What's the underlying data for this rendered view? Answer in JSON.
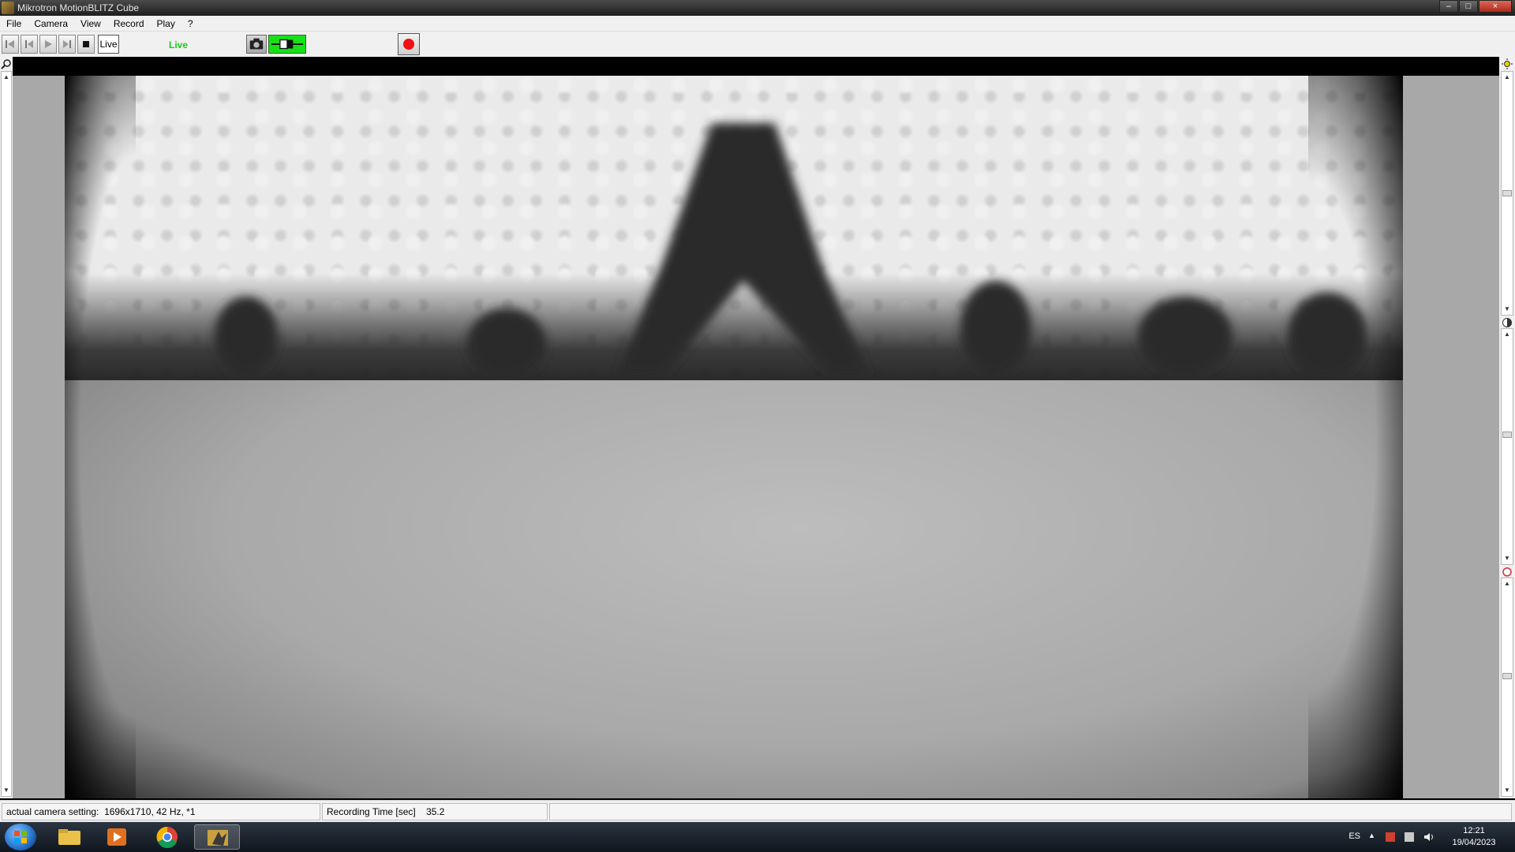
{
  "window": {
    "title": "Mikrotron MotionBLITZ Cube"
  },
  "menu": [
    "File",
    "Camera",
    "View",
    "Record",
    "Play",
    "?"
  ],
  "toolbar": {
    "live_button": "Live",
    "live_status": "Live"
  },
  "status": {
    "camera_setting_label": "actual camera setting:",
    "camera_setting_value": "1696x1710, 42 Hz, *1",
    "recording_time_label": "Recording Time [sec]",
    "recording_time_value": "35.2"
  },
  "taskbar": {
    "language": "ES",
    "time": "12:21",
    "date": "19/04/2023"
  },
  "colors": {
    "live_green": "#16d016",
    "record_red": "#f01010",
    "connected_green": "#18e018"
  }
}
